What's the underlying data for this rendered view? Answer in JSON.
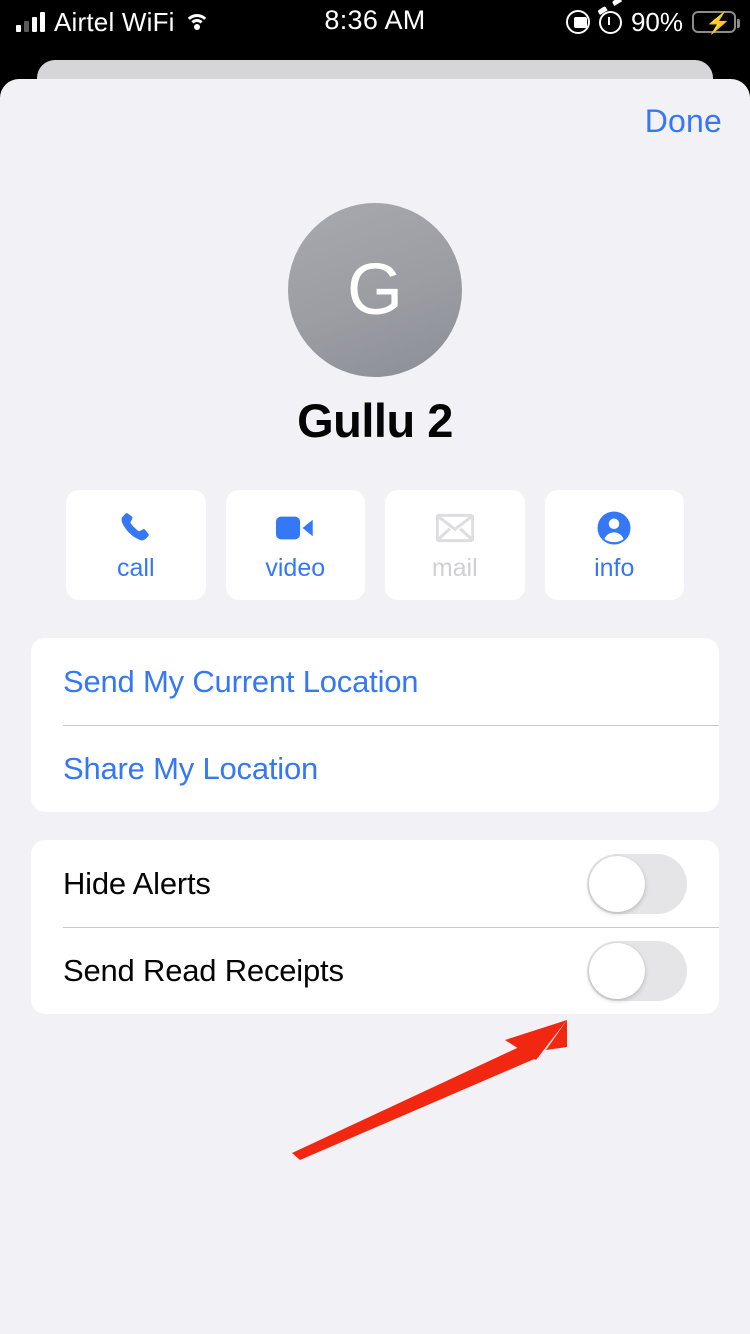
{
  "status_bar": {
    "signal_icon": "cellular-bars-icon",
    "carrier": "Airtel WiFi",
    "wifi_icon": "wifi-icon",
    "time": "8:36 AM",
    "rotation_lock_icon": "rotation-lock-icon",
    "alarm_icon": "alarm-clock-icon",
    "battery_percent": "90%",
    "battery_icon": "battery-charging-icon"
  },
  "sheet": {
    "done_label": "Done",
    "avatar": {
      "monogram": "G",
      "icon": "avatar-monogram"
    },
    "contact_name": "Gullu 2",
    "actions": [
      {
        "label": "call",
        "icon": "phone-icon",
        "enabled": true
      },
      {
        "label": "video",
        "icon": "video-camera-icon",
        "enabled": true
      },
      {
        "label": "mail",
        "icon": "envelope-icon",
        "enabled": false
      },
      {
        "label": "info",
        "icon": "person-circle-icon",
        "enabled": true
      }
    ],
    "location_group": [
      {
        "label": "Send My Current Location"
      },
      {
        "label": "Share My Location"
      }
    ],
    "toggle_group": [
      {
        "label": "Hide Alerts",
        "state": "off"
      },
      {
        "label": "Send Read Receipts",
        "state": "off"
      }
    ]
  },
  "annotation": {
    "arrow_color": "#f22711",
    "points_to": "Send Read Receipts toggle"
  },
  "colors": {
    "accent_blue": "#3478f6",
    "sheet_bg": "#f2f1f6",
    "card_bg": "#ffffff",
    "disabled_gray": "#cfcfd4",
    "switch_track": "#e5e5e7"
  }
}
